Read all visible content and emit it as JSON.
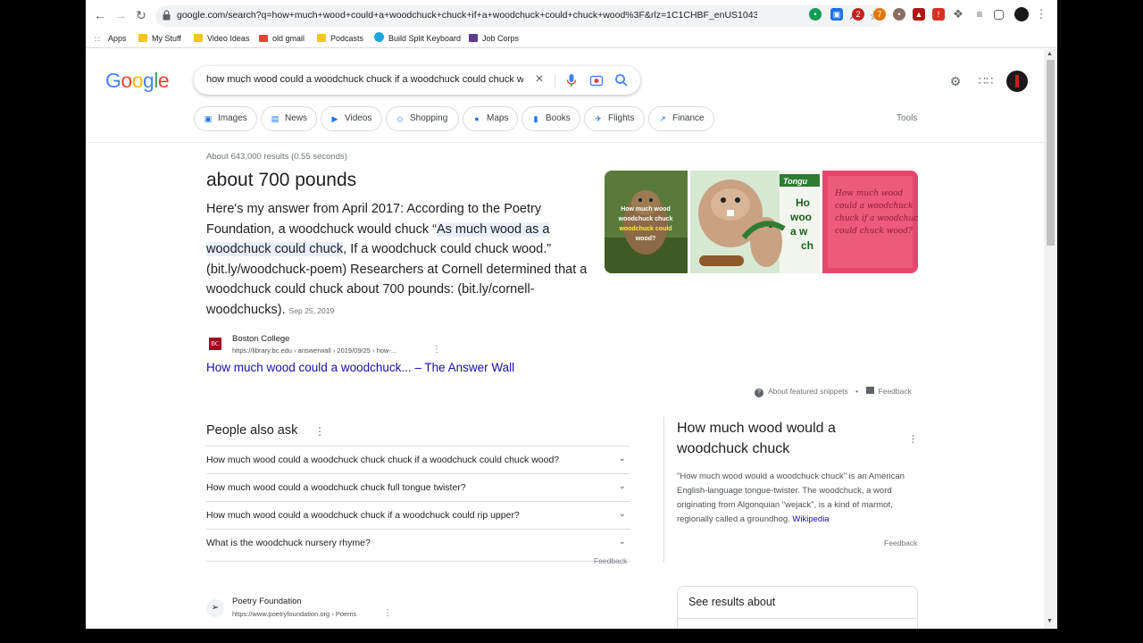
{
  "browser": {
    "url": "google.com/search?q=how+much+wood+could+a+woodchuck+chuck+if+a+woodchuck+could+chuck+wood%3F&rlz=1C1CHBF_enUS1043...",
    "bookmarks": [
      "Apps",
      "My Stuff",
      "Video Ideas",
      "old gmail",
      "Podcasts",
      "Build Split Keyboard",
      "Job Corps"
    ]
  },
  "search": {
    "query": "how much wood could a woodchuck chuck if a woodchuck could chuck wood?"
  },
  "chips": [
    "Images",
    "News",
    "Videos",
    "Shopping",
    "Maps",
    "Books",
    "Flights",
    "Finance"
  ],
  "tools_label": "Tools",
  "results": {
    "stats": "About 643,000 results (0.55 seconds)",
    "answer": "about 700 pounds",
    "snippet_pre": "Here's my answer from April 2017: According to the Poetry Foundation, a woodchuck would chuck “",
    "snippet_highlight": "As much wood as a woodchuck could chuck",
    "snippet_post": ", If a woodchuck could chuck wood.” (bit.ly/woodchuck-poem) Researchers at Cornell determined that a woodchuck could chuck about 700 pounds: (bit.ly/cornell-woodchucks).",
    "snippet_date": "Sep 25, 2019",
    "source_name": "Boston College",
    "source_url": "https://library.bc.edu › answerwall › 2019/09/25 › how-...",
    "source_link": "How much wood could a woodchuck... – The Answer Wall",
    "about_snippets": "About featured snippets",
    "feedback": "Feedback",
    "image1_text": "How much wood would a woodchuck chuck if a woodchuck could chuck wood?",
    "image2_text": "How wood would a woodchuck chuck",
    "image2_banner": "Tongue",
    "image3_text": "How much wood could a woodchuck chuck if a woodchuck could chuck wood?"
  },
  "paa": {
    "title": "People also ask",
    "questions": [
      "How much wood could a woodchuck chuck chuck if a woodchuck could chuck wood?",
      "How much wood could a woodchuck chuck full tongue twister?",
      "How much wood could a woodchuck chuck if a woodchuck could rip upper?",
      "What is the woodchuck nursery rhyme?"
    ],
    "feedback": "Feedback"
  },
  "knowledge": {
    "title": "How much wood would a woodchuck chuck",
    "description": "\"How much wood would a woodchuck chuck\" is an American English-language tongue-twister. The woodchuck, a word originating from Algonquian \"wejack\", is a kind of marmot, regionally called a groundhog.",
    "source": "Wikipedia",
    "feedback": "Feedback",
    "see_results": "See results about"
  },
  "result2": {
    "name": "Poetry Foundation",
    "url": "https://www.poetryfoundation.org › Poems"
  },
  "colors": {
    "link": "#1a0dab",
    "highlight": "#e8f0fe",
    "google_blue": "#4285f4",
    "google_red": "#ea4335",
    "google_yellow": "#fbbc05",
    "google_green": "#34a853"
  }
}
